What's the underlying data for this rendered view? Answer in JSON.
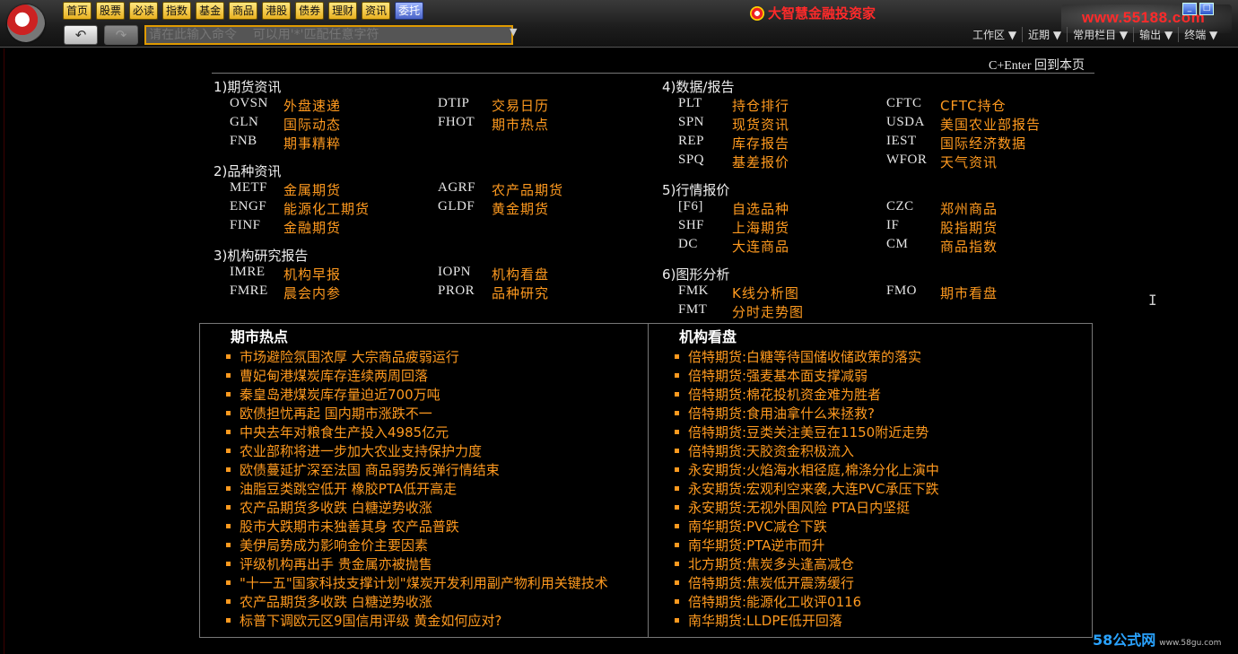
{
  "nav": [
    "首页",
    "股票",
    "必读",
    "指数",
    "基金",
    "商品",
    "港股",
    "债券",
    "理财",
    "资讯",
    "委托"
  ],
  "nav_active_index": 10,
  "command": {
    "placeholder": "请在此输入命令    可以用'*'匹配任意字符"
  },
  "brand": "大智慧金融投资家",
  "site_url": "www.55188.com",
  "window_controls": [
    "_",
    "□"
  ],
  "right_menu": [
    "工作区 ▼",
    "近期 ▼",
    "常用栏目 ▼",
    "输出 ▼",
    "终端 ▼"
  ],
  "return_hint": "C+Enter 回到本页",
  "sections": {
    "futures_news": {
      "title": "1)期货资讯",
      "items": [
        [
          "OVSN",
          "外盘速递"
        ],
        [
          "DTIP",
          "交易日历"
        ],
        [
          "GLN",
          "国际动态"
        ],
        [
          "FHOT",
          "期市热点"
        ],
        [
          "FNB",
          "期事精粹"
        ]
      ]
    },
    "variety_news": {
      "title": "2)品种资讯",
      "items": [
        [
          "METF",
          "金属期货"
        ],
        [
          "AGRF",
          "农产品期货"
        ],
        [
          "ENGF",
          "能源化工期货"
        ],
        [
          "GLDF",
          "黄金期货"
        ],
        [
          "FINF",
          "金融期货"
        ]
      ]
    },
    "institution": {
      "title": "3)机构研究报告",
      "items": [
        [
          "IMRE",
          "机构早报"
        ],
        [
          "IOPN",
          "机构看盘"
        ],
        [
          "FMRE",
          "晨会内参"
        ],
        [
          "PROR",
          "品种研究"
        ]
      ]
    },
    "data_report": {
      "title": "4)数据/报告",
      "items": [
        [
          "PLT",
          "持仓排行"
        ],
        [
          "CFTC",
          "CFTC持仓"
        ],
        [
          "SPN",
          "现货资讯"
        ],
        [
          "USDA",
          "美国农业部报告"
        ],
        [
          "REP",
          "库存报告"
        ],
        [
          "IEST",
          "国际经济数据"
        ],
        [
          "SPQ",
          "基差报价"
        ],
        [
          "WFOR",
          "天气资讯"
        ]
      ]
    },
    "quotes": {
      "title": "5)行情报价",
      "items": [
        [
          "[F6]",
          "自选品种"
        ],
        [
          "CZC",
          "郑州商品"
        ],
        [
          "SHF",
          "上海期货"
        ],
        [
          "IF",
          "股指期货"
        ],
        [
          "DC",
          "大连商品"
        ],
        [
          "CM",
          "商品指数"
        ]
      ]
    },
    "charts": {
      "title": "6)图形分析",
      "items": [
        [
          "FMK",
          "K线分析图"
        ],
        [
          "FMO",
          "期市看盘"
        ],
        [
          "FMT",
          "分时走势图"
        ]
      ]
    }
  },
  "hot": {
    "title": "期市热点",
    "items": [
      "市场避险氛围浓厚 大宗商品疲弱运行",
      "曹妃甸港煤炭库存连续两周回落",
      "秦皇岛港煤炭库存量迫近700万吨",
      "欧债担忧再起 国内期市涨跌不一",
      "中央去年对粮食生产投入4985亿元",
      "农业部称将进一步加大农业支持保护力度",
      "欧债蔓延扩深至法国 商品弱势反弹行情结束",
      "油脂豆类跳空低开 橡胶PTA低开高走",
      "农产品期货多收跌 白糖逆势收涨",
      "股市大跌期市未独善其身 农产品普跌",
      "美伊局势成为影响金价主要因素",
      "评级机构再出手 贵金属亦被抛售",
      "\"十一五\"国家科技支撑计划\"煤炭开发利用副产物利用关键技术",
      "农产品期货多收跌 白糖逆势收涨",
      "标普下调欧元区9国信用评级 黄金如何应对?"
    ]
  },
  "inst": {
    "title": "机构看盘",
    "items": [
      "倍特期货:白糖等待国储收储政策的落实",
      "倍特期货:强麦基本面支撑减弱",
      "倍特期货:棉花投机资金难为胜者",
      "倍特期货:食用油拿什么来拯救?",
      "倍特期货:豆类关注美豆在1150附近走势",
      "倍特期货:天胶资金积极流入",
      "永安期货:火焰海水相径庭,棉涤分化上演中",
      "永安期货:宏观利空来袭,大连PVC承压下跌",
      "永安期货:无视外围风险 PTA日内坚挺",
      "南华期货:PVC减仓下跌",
      "南华期货:PTA逆市而升",
      "北方期货:焦炭多头逢高减仓",
      "倍特期货:焦炭低开震荡缓行",
      "倍特期货:能源化工收评0116",
      "南华期货:LLDPE低开回落"
    ]
  },
  "watermark": {
    "main": "58公式网",
    "sub": "www.58gu.com"
  },
  "colors": {
    "accent": "#ff9a1f",
    "nav_bg": "#f0c030",
    "nav_active": "#4a64c8",
    "brand": "#ff2a2a"
  }
}
